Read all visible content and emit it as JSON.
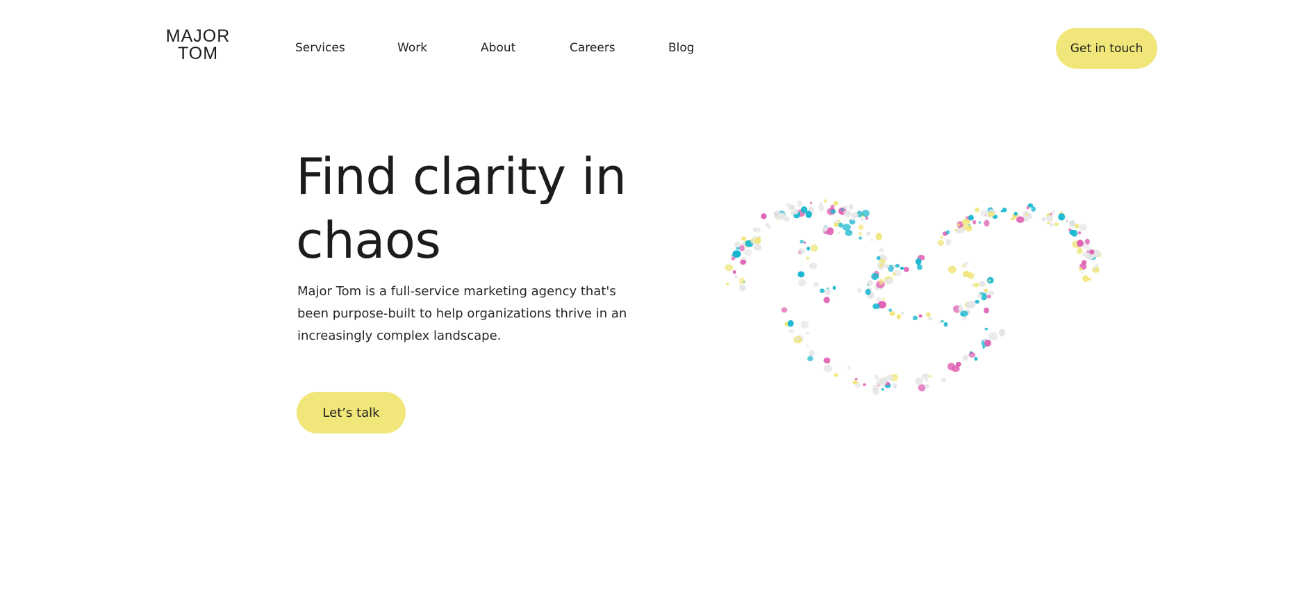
{
  "brand": {
    "logo_line1": "MAJOR",
    "logo_line2": "TOM"
  },
  "nav": {
    "items": [
      {
        "label": "Services"
      },
      {
        "label": "Work"
      },
      {
        "label": "About"
      },
      {
        "label": "Careers"
      },
      {
        "label": "Blog"
      }
    ],
    "cta_label": "Get in touch"
  },
  "hero": {
    "title": "Find clarity in chaos",
    "body": "Major Tom is a full-service marketing agency that's been purpose-built to help organizations thrive in an increasingly complex landscape.",
    "cta_label": "Let’s talk"
  },
  "colors": {
    "accent": "#f0e67a",
    "text": "#1e1e1e",
    "particle_cyan": "#19b7cf",
    "particle_pink": "#e062b4",
    "particle_yellow": "#f0e67a",
    "particle_grey": "#e6e6e6"
  }
}
